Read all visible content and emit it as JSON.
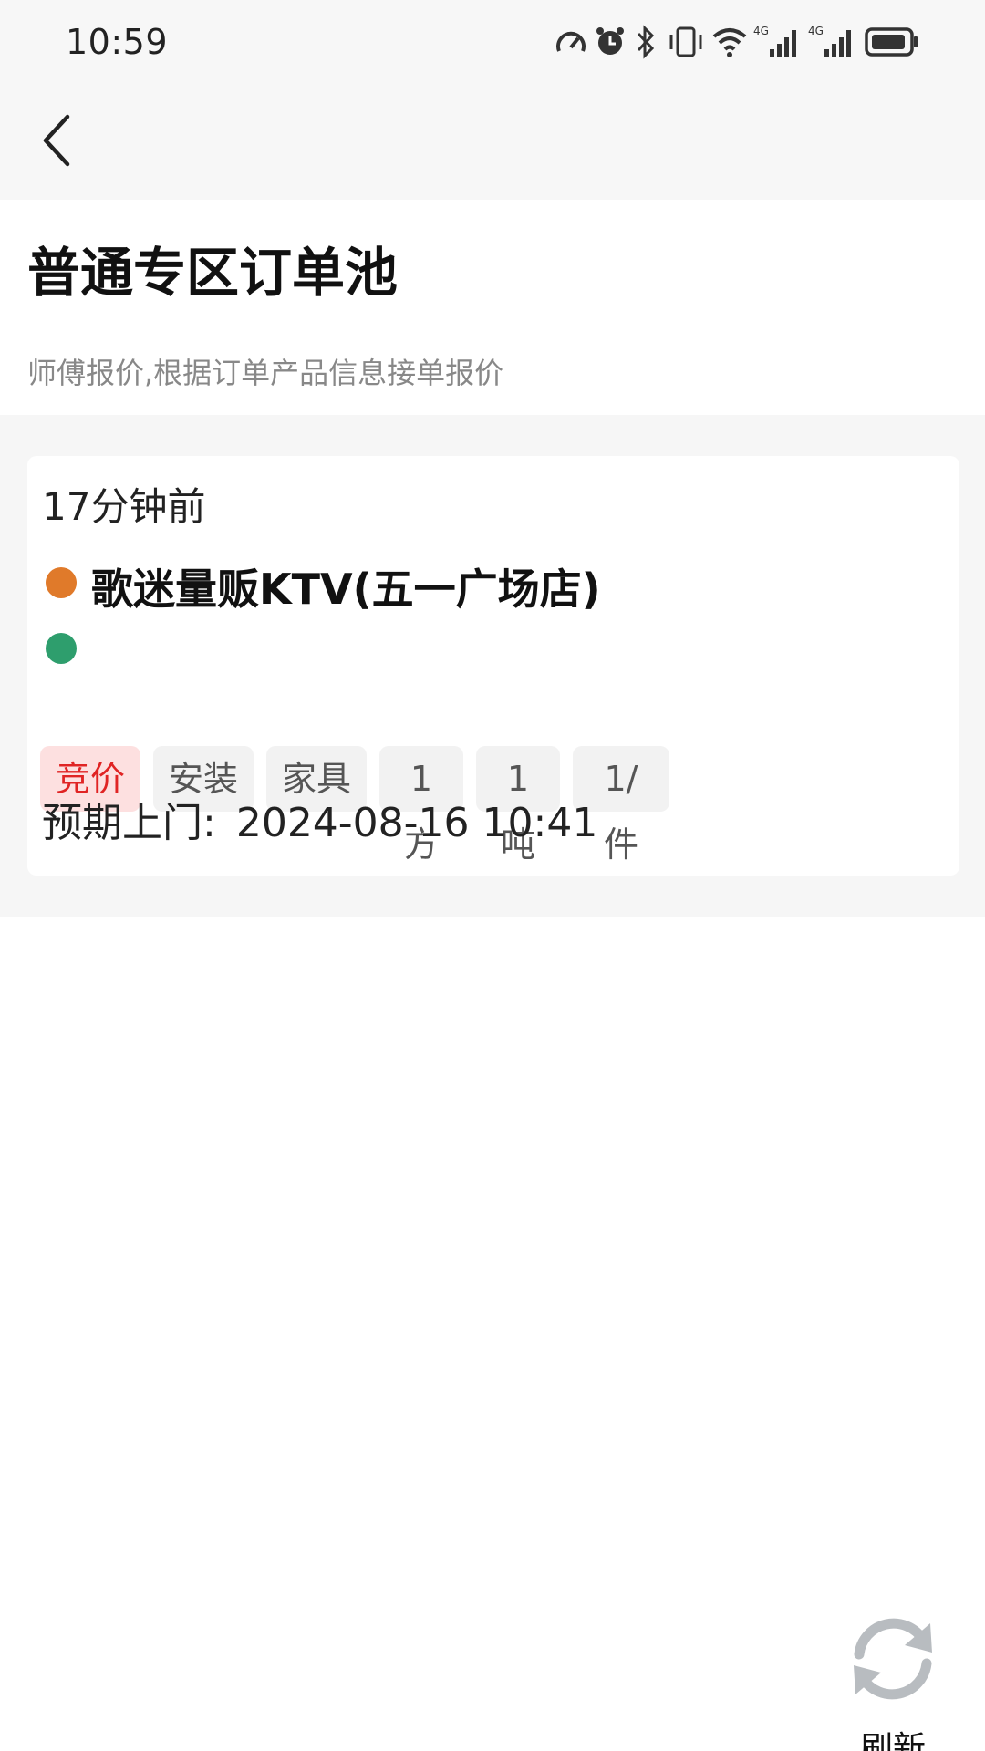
{
  "status_bar": {
    "time": "10:59",
    "icons": [
      "speed-icon",
      "alarm-icon",
      "bluetooth-icon",
      "vibrate-icon",
      "wifi-icon",
      "signal-4g-icon",
      "signal-4g-icon",
      "battery-icon"
    ],
    "signal_label_1": "4G",
    "signal_label_2": "4G"
  },
  "nav": {
    "back_icon": "chevron-left-icon"
  },
  "header": {
    "title": "普通专区订单池",
    "subtitle": "师傅报价,根据订单产品信息接单报价"
  },
  "orders": [
    {
      "time_ago": "17分钟前",
      "from_name": "歌迷量贩KTV(五一广场店)",
      "to_name": "",
      "tags": [
        "竞价",
        "安装",
        "家具",
        "1方",
        "1吨",
        "1/件"
      ],
      "expected_label": "预期上门:",
      "expected_time": "2024-08-16 10:41"
    }
  ],
  "refresh": {
    "label": "刷新",
    "icon": "refresh-icon"
  },
  "colors": {
    "from_dot": "#e07a2a",
    "to_dot": "#2e9e6d",
    "bid_tag_bg": "#fde0e0",
    "bid_tag_text": "#e02424",
    "tag_bg": "#f2f2f2"
  }
}
